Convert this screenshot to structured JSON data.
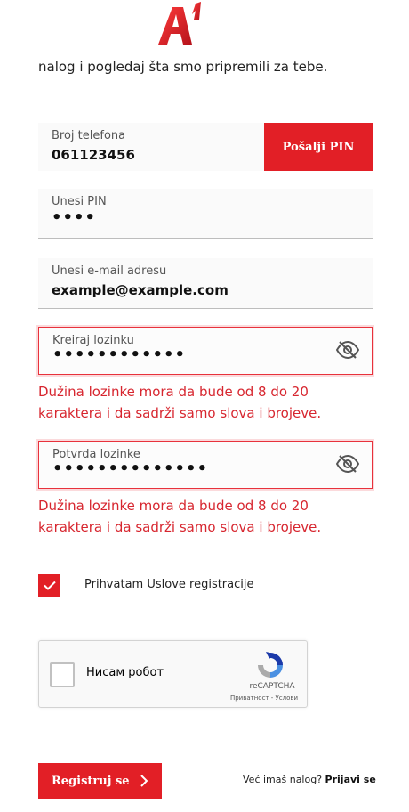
{
  "brand": {
    "logo_text": "A1",
    "color": "#e21f26"
  },
  "intro_text": "nalog i pogledaj šta smo pripremili za tebe.",
  "phone": {
    "label": "Broj telefona",
    "value": "061123456",
    "send_pin_label": "Pošalji PIN"
  },
  "pin": {
    "label": "Unesi PIN",
    "value": "••••"
  },
  "email": {
    "label": "Unesi e-mail adresu",
    "value": "example@example.com"
  },
  "password": {
    "label": "Kreiraj lozinku",
    "value": "••••••••••••",
    "error": "Dužina lozinke mora da bude od 8 do 20 karaktera i da sadrži samo slova i brojeve.",
    "icon": "eye-off-icon"
  },
  "confirm_password": {
    "label": "Potvrda lozinke",
    "value": "••••••••••••••",
    "error": "Dužina lozinke mora da bude od 8 do 20 karaktera i da sadrži samo slova i brojeve.",
    "icon": "eye-off-icon"
  },
  "terms": {
    "checked": true,
    "prefix": "Prihvatam",
    "link": "Uslove registracije"
  },
  "recaptcha": {
    "label": "Нисам робот",
    "brand": "reCAPTCHA",
    "terms": "Приватност - Услови"
  },
  "register": {
    "label": "Registruj se"
  },
  "login": {
    "prefix": "Već imaš nalog?",
    "link": "Prijavi se"
  },
  "colors": {
    "accent": "#e21f26",
    "error": "#d7262f",
    "field_bg": "#fafafa"
  }
}
